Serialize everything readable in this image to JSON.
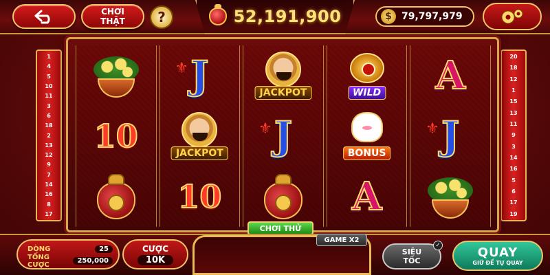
{
  "top": {
    "real_play_label_1": "CHƠI",
    "real_play_label_2": "THẬT",
    "help_label": "?",
    "jackpot_value": "52,191,900",
    "currency_symbol": "$",
    "balance": "79,797,979"
  },
  "paylines": {
    "left": [
      "1",
      "4",
      "5",
      "10",
      "11",
      "3",
      "6",
      "18",
      "2",
      "13",
      "12",
      "9",
      "7",
      "14",
      "16",
      "8",
      "17"
    ],
    "right": [
      "20",
      "18",
      "12",
      "1",
      "15",
      "13",
      "11",
      "9",
      "3",
      "14",
      "16",
      "5",
      "6",
      "17",
      "19"
    ]
  },
  "reels": {
    "r1": {
      "mid": "10"
    },
    "r2": {
      "top": "J",
      "mid_tag": "JACKPOT",
      "bot": "10"
    },
    "r3": {
      "top_tag": "JACKPOT",
      "mid": "J"
    },
    "r4": {
      "top_tag": "WILD",
      "mid_tag": "BONUS",
      "bot": "A"
    },
    "r5": {
      "top": "A",
      "mid": "J"
    }
  },
  "demo_tag": "CHƠI THỬ",
  "bottom": {
    "lines_label": "DÒNG",
    "lines_value": "25",
    "total_bet_label": "TỔNG CƯỢC",
    "total_bet_value": "250,000",
    "bet_label": "CƯỢC",
    "bet_value": "10K",
    "game_x2": "GAME X2",
    "turbo_1": "SIÊU",
    "turbo_2": "TỐC",
    "spin_label": "QUAY",
    "spin_sub": "GIỮ ĐỂ TỰ QUAY"
  }
}
